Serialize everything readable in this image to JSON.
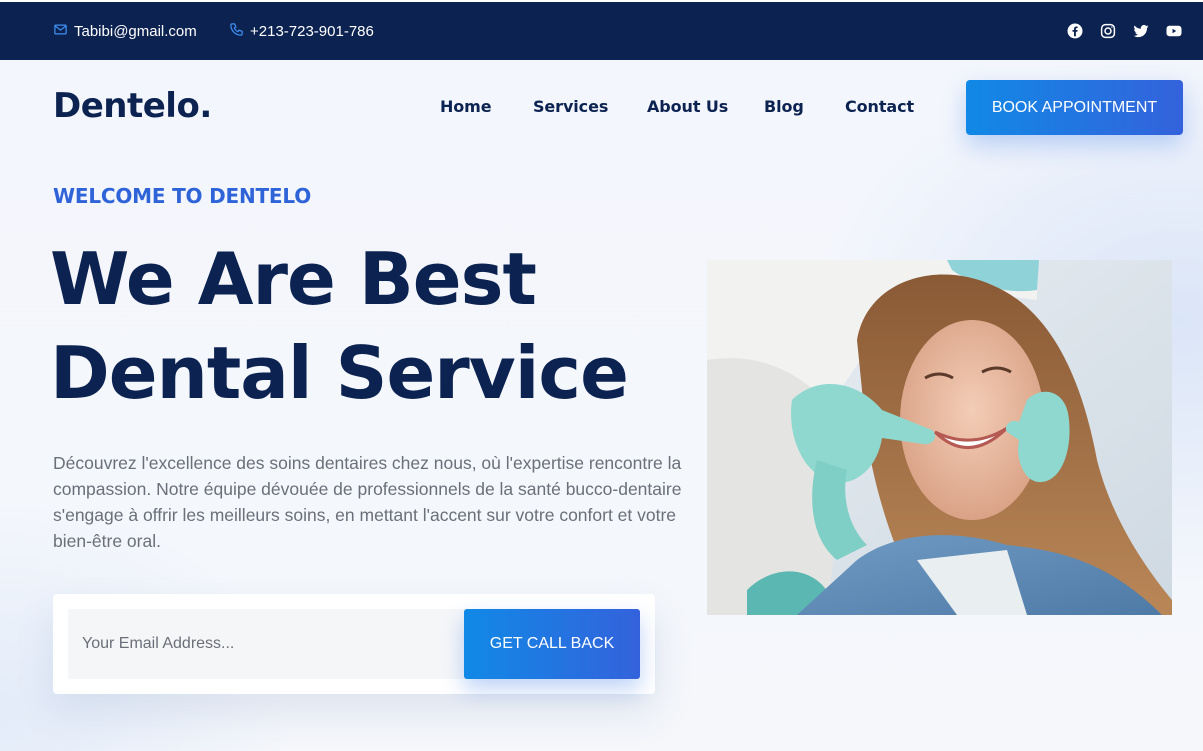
{
  "topbar": {
    "email": "Tabibi@gmail.com",
    "phone": "+213-723-901-786",
    "social": [
      "facebook-icon",
      "instagram-icon",
      "twitter-icon",
      "youtube-icon"
    ]
  },
  "header": {
    "logo": "Dentelo.",
    "nav": [
      "Home",
      "Services",
      "About Us",
      "Blog",
      "Contact"
    ],
    "book_label": "BOOK APPOINTMENT"
  },
  "hero": {
    "eyebrow": "WELCOME TO DENTELO",
    "title_line1": "We Are Best",
    "title_line2": "Dental Service",
    "description": "Découvrez l'excellence des soins dentaires chez nous, où l'expertise rencontre la compassion. Notre équipe dévouée de professionnels de la santé bucco-dentaire s'engage à offrir les meilleurs soins, en mettant l'accent sur votre confort et votre bien-être oral.",
    "email_placeholder": "Your Email Address...",
    "cta_label": "GET CALL BACK"
  },
  "colors": {
    "navy": "#0c2250",
    "accent": "#2f63d8",
    "button_start": "#1189e6",
    "button_end": "#3462dc"
  }
}
